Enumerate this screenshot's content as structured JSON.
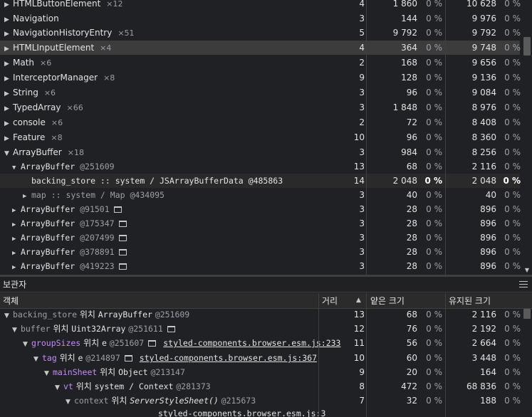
{
  "constructors": [
    {
      "name": "HTMLButtonElement",
      "count": "×12",
      "distance": "4",
      "shallow": "1 860",
      "shallow_pct": "0 %",
      "retained": "10 628",
      "retained_pct": "0 %"
    },
    {
      "name": "Navigation",
      "count": "",
      "distance": "3",
      "shallow": "144",
      "shallow_pct": "0 %",
      "retained": "9 976",
      "retained_pct": "0 %"
    },
    {
      "name": "NavigationHistoryEntry",
      "count": "×51",
      "distance": "5",
      "shallow": "9 792",
      "shallow_pct": "0 %",
      "retained": "9 792",
      "retained_pct": "0 %"
    },
    {
      "name": "HTMLInputElement",
      "count": "×4",
      "distance": "4",
      "shallow": "364",
      "shallow_pct": "0 %",
      "retained": "9 748",
      "retained_pct": "0 %"
    },
    {
      "name": "Math",
      "count": "×6",
      "distance": "2",
      "shallow": "168",
      "shallow_pct": "0 %",
      "retained": "9 656",
      "retained_pct": "0 %"
    },
    {
      "name": "InterceptorManager",
      "count": "×8",
      "distance": "9",
      "shallow": "128",
      "shallow_pct": "0 %",
      "retained": "9 136",
      "retained_pct": "0 %"
    },
    {
      "name": "String",
      "count": "×6",
      "distance": "3",
      "shallow": "96",
      "shallow_pct": "0 %",
      "retained": "9 084",
      "retained_pct": "0 %"
    },
    {
      "name": "TypedArray",
      "count": "×66",
      "distance": "3",
      "shallow": "1 848",
      "shallow_pct": "0 %",
      "retained": "8 976",
      "retained_pct": "0 %"
    },
    {
      "name": "console",
      "count": "×6",
      "distance": "2",
      "shallow": "72",
      "shallow_pct": "0 %",
      "retained": "8 408",
      "retained_pct": "0 %"
    },
    {
      "name": "Feature",
      "count": "×8",
      "distance": "10",
      "shallow": "96",
      "shallow_pct": "0 %",
      "retained": "8 360",
      "retained_pct": "0 %"
    },
    {
      "name": "ArrayBuffer",
      "count": "×18",
      "distance": "3",
      "shallow": "984",
      "shallow_pct": "0 %",
      "retained": "8 256",
      "retained_pct": "0 %"
    }
  ],
  "instances": [
    {
      "name": "ArrayBuffer",
      "id": "@251609",
      "distance": "13",
      "shallow": "68",
      "shallow_pct": "0 %",
      "retained": "2 116",
      "retained_pct": "0 %"
    },
    {
      "name": "backing_store :: system / JSArrayBufferData",
      "id": "@485863",
      "distance": "14",
      "shallow": "2 048",
      "shallow_pct": "0 %",
      "retained": "2 048",
      "retained_pct": "0 %"
    },
    {
      "name": "map :: system / Map",
      "id": "@434095",
      "distance": "3",
      "shallow": "40",
      "shallow_pct": "0 %",
      "retained": "40",
      "retained_pct": "0 %"
    },
    {
      "name": "ArrayBuffer",
      "id": "@91501",
      "distance": "3",
      "shallow": "28",
      "shallow_pct": "0 %",
      "retained": "896",
      "retained_pct": "0 %"
    },
    {
      "name": "ArrayBuffer",
      "id": "@175347",
      "distance": "3",
      "shallow": "28",
      "shallow_pct": "0 %",
      "retained": "896",
      "retained_pct": "0 %"
    },
    {
      "name": "ArrayBuffer",
      "id": "@207499",
      "distance": "3",
      "shallow": "28",
      "shallow_pct": "0 %",
      "retained": "896",
      "retained_pct": "0 %"
    },
    {
      "name": "ArrayBuffer",
      "id": "@378891",
      "distance": "3",
      "shallow": "28",
      "shallow_pct": "0 %",
      "retained": "896",
      "retained_pct": "0 %"
    },
    {
      "name": "ArrayBuffer",
      "id": "@419223",
      "distance": "3",
      "shallow": "28",
      "shallow_pct": "0 %",
      "retained": "896",
      "retained_pct": "0 %"
    }
  ],
  "retainers_panel": {
    "title": "보관자",
    "columns": {
      "object": "객체",
      "distance": "거리",
      "shallow": "얕은 크기",
      "retained": "유지된 크기"
    }
  },
  "retainers": [
    {
      "prop": "backing_store",
      "word": "위치",
      "obj": "ArrayBuffer",
      "id": "@251609",
      "link": "",
      "distance": "13",
      "shallow": "68",
      "shallow_pct": "0 %",
      "retained": "2 116",
      "retained_pct": "0 %"
    },
    {
      "prop": "buffer",
      "word": "위치",
      "obj": "Uint32Array",
      "id": "@251611",
      "link": "",
      "distance": "12",
      "shallow": "76",
      "shallow_pct": "0 %",
      "retained": "2 192",
      "retained_pct": "0 %"
    },
    {
      "prop": "groupSizes",
      "word": "위치",
      "obj": "e",
      "id": "@251607",
      "link": "styled-components.browser.esm.js:233",
      "distance": "11",
      "shallow": "56",
      "shallow_pct": "0 %",
      "retained": "2 664",
      "retained_pct": "0 %"
    },
    {
      "prop": "tag",
      "word": "위치",
      "obj": "e",
      "id": "@214897",
      "link": "styled-components.browser.esm.js:367",
      "distance": "10",
      "shallow": "60",
      "shallow_pct": "0 %",
      "retained": "3 448",
      "retained_pct": "0 %"
    },
    {
      "prop": "mainSheet",
      "word": "위치",
      "obj": "Object",
      "id": "@213147",
      "link": "",
      "distance": "9",
      "shallow": "20",
      "shallow_pct": "0 %",
      "retained": "164",
      "retained_pct": "0 %"
    },
    {
      "prop": "vt",
      "word": "위치",
      "obj": "system / Context",
      "id": "@281373",
      "link": "",
      "distance": "8",
      "shallow": "472",
      "shallow_pct": "0 %",
      "retained": "68 836",
      "retained_pct": "0 %"
    },
    {
      "prop": "context",
      "word": "위치",
      "obj": "ServerStyleSheet()",
      "id": "@215673",
      "link": "",
      "distance": "7",
      "shallow": "32",
      "shallow_pct": "0 %",
      "retained": "188",
      "retained_pct": "0 %"
    }
  ],
  "retainer_tail_link": "styled-components.browser.esm.js:3"
}
